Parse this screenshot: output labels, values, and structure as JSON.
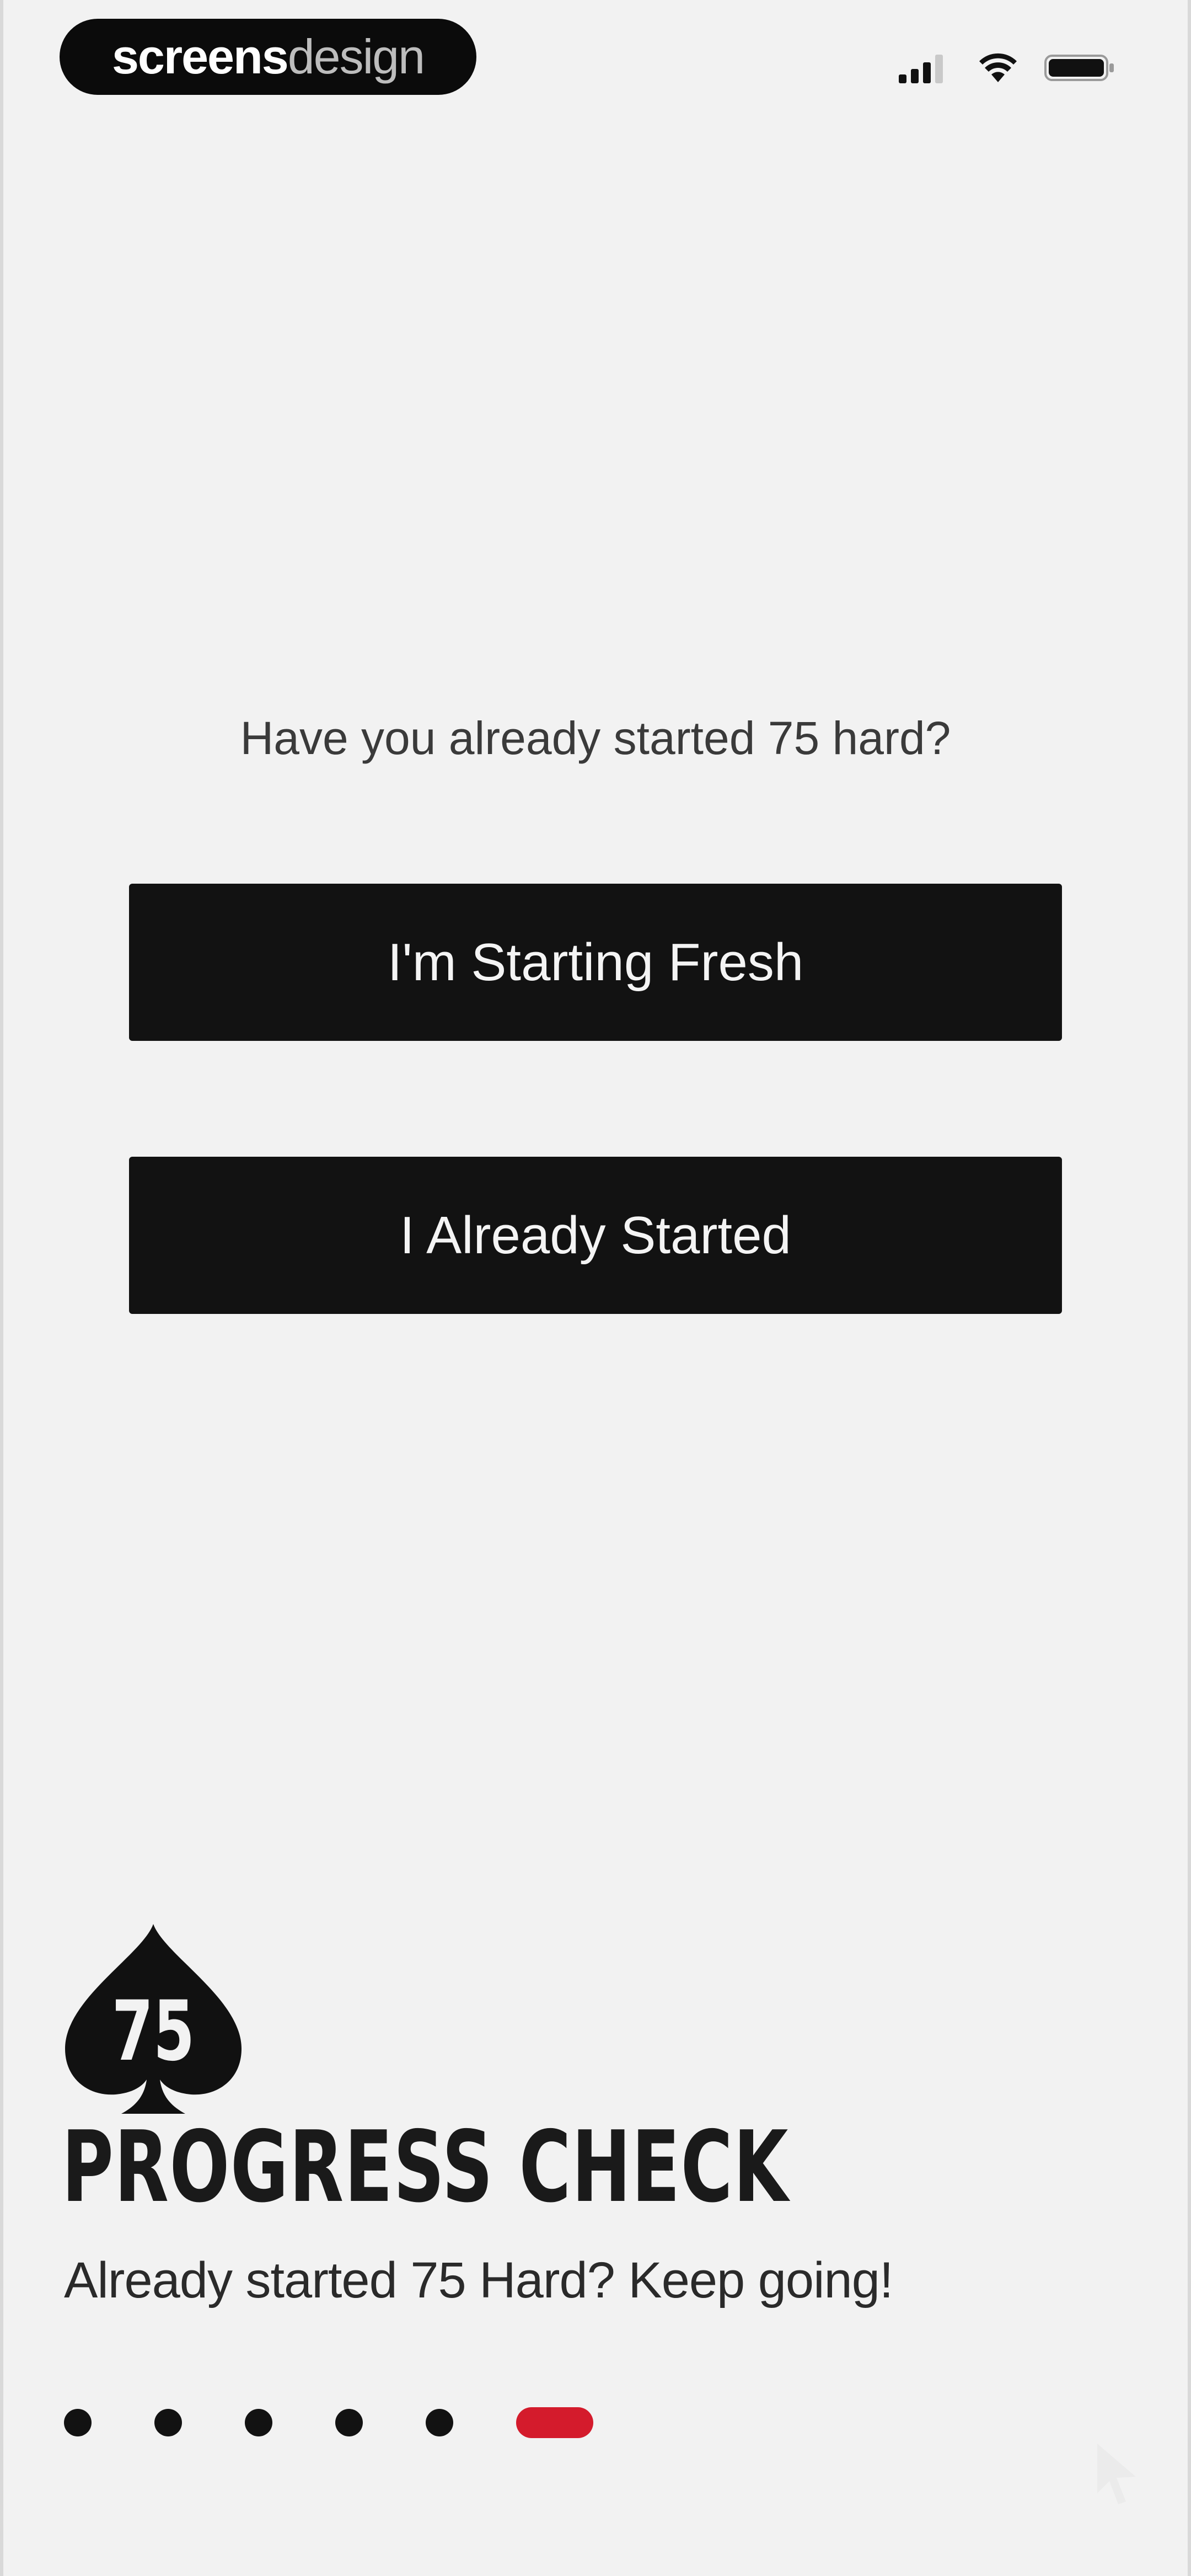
{
  "status_bar": {
    "brand_bold": "screens",
    "brand_light": "design",
    "icons": [
      "signal-icon",
      "wifi-icon",
      "battery-icon"
    ]
  },
  "onboarding": {
    "question": "Have you already started 75 hard?",
    "buttons": {
      "fresh_label": "I'm Starting Fresh",
      "started_label": "I Already Started"
    }
  },
  "info": {
    "logo_number": "75",
    "headline": "PROGRESS CHECK",
    "subline": "Already started 75 Hard? Keep going!"
  },
  "pager": {
    "total_pages": 6,
    "active_page": 6
  },
  "colors": {
    "background": "#f2f2f2",
    "button_bg": "#121212",
    "button_text": "#f4f4f4",
    "accent_active_dot": "#d41b2c"
  }
}
